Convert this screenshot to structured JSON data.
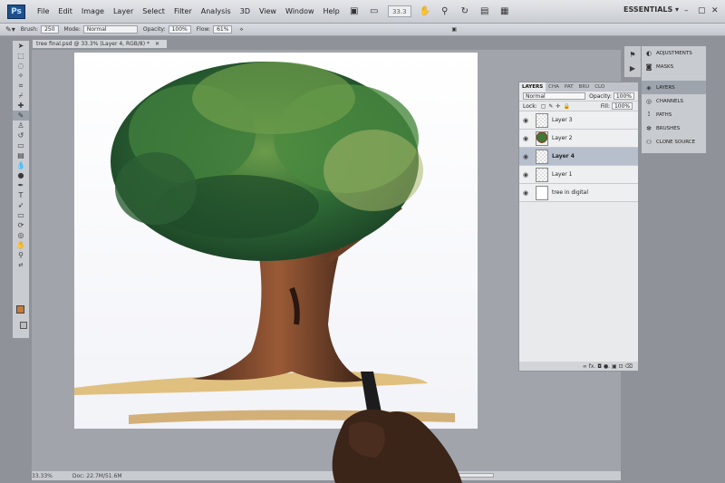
{
  "app": {
    "logo": "Ps"
  },
  "menu": [
    "File",
    "Edit",
    "Image",
    "Layer",
    "Select",
    "Filter",
    "Analysis",
    "3D",
    "View",
    "Window",
    "Help"
  ],
  "toolbar": {
    "zoom": "33.3"
  },
  "workspace": {
    "label": "ESSENTIALS ▾"
  },
  "options": {
    "brush_label": "Brush:",
    "brush_size": "250",
    "mode_label": "Mode:",
    "mode_value": "Normal",
    "opacity_label": "Opacity:",
    "opacity_value": "100%",
    "flow_label": "Flow:",
    "flow_value": "61%"
  },
  "document": {
    "tab_title": "tree final.psd @ 33.3% (Layer 4, RGB/8) *",
    "status_zoom": "33.33%",
    "status_doc": "Doc: 22.7M/51.6M"
  },
  "layers_panel": {
    "tabs": [
      "LAYERS",
      "CHA",
      "PAT",
      "BRU",
      "CLO"
    ],
    "blend_mode": "Normal",
    "opacity_label": "Opacity:",
    "opacity_value": "100%",
    "lock_label": "Lock:",
    "fill_label": "Fill:",
    "fill_value": "100%",
    "layers": [
      {
        "name": "Layer 3"
      },
      {
        "name": "Layer 2"
      },
      {
        "name": "Layer 4"
      },
      {
        "name": "Layer 1"
      },
      {
        "name": "tree in digital"
      }
    ],
    "footer_icons": "∞  fx.  ◘  ●.  ▣  ⊡  ⌫"
  },
  "dock": {
    "items": [
      "ADJUSTMENTS",
      "MASKS",
      "LAYERS",
      "CHANNELS",
      "PATHS",
      "BRUSHES",
      "CLONE SOURCE"
    ]
  },
  "colors": {
    "foreground": "#c67a3a",
    "background": "#b9bcc0"
  }
}
